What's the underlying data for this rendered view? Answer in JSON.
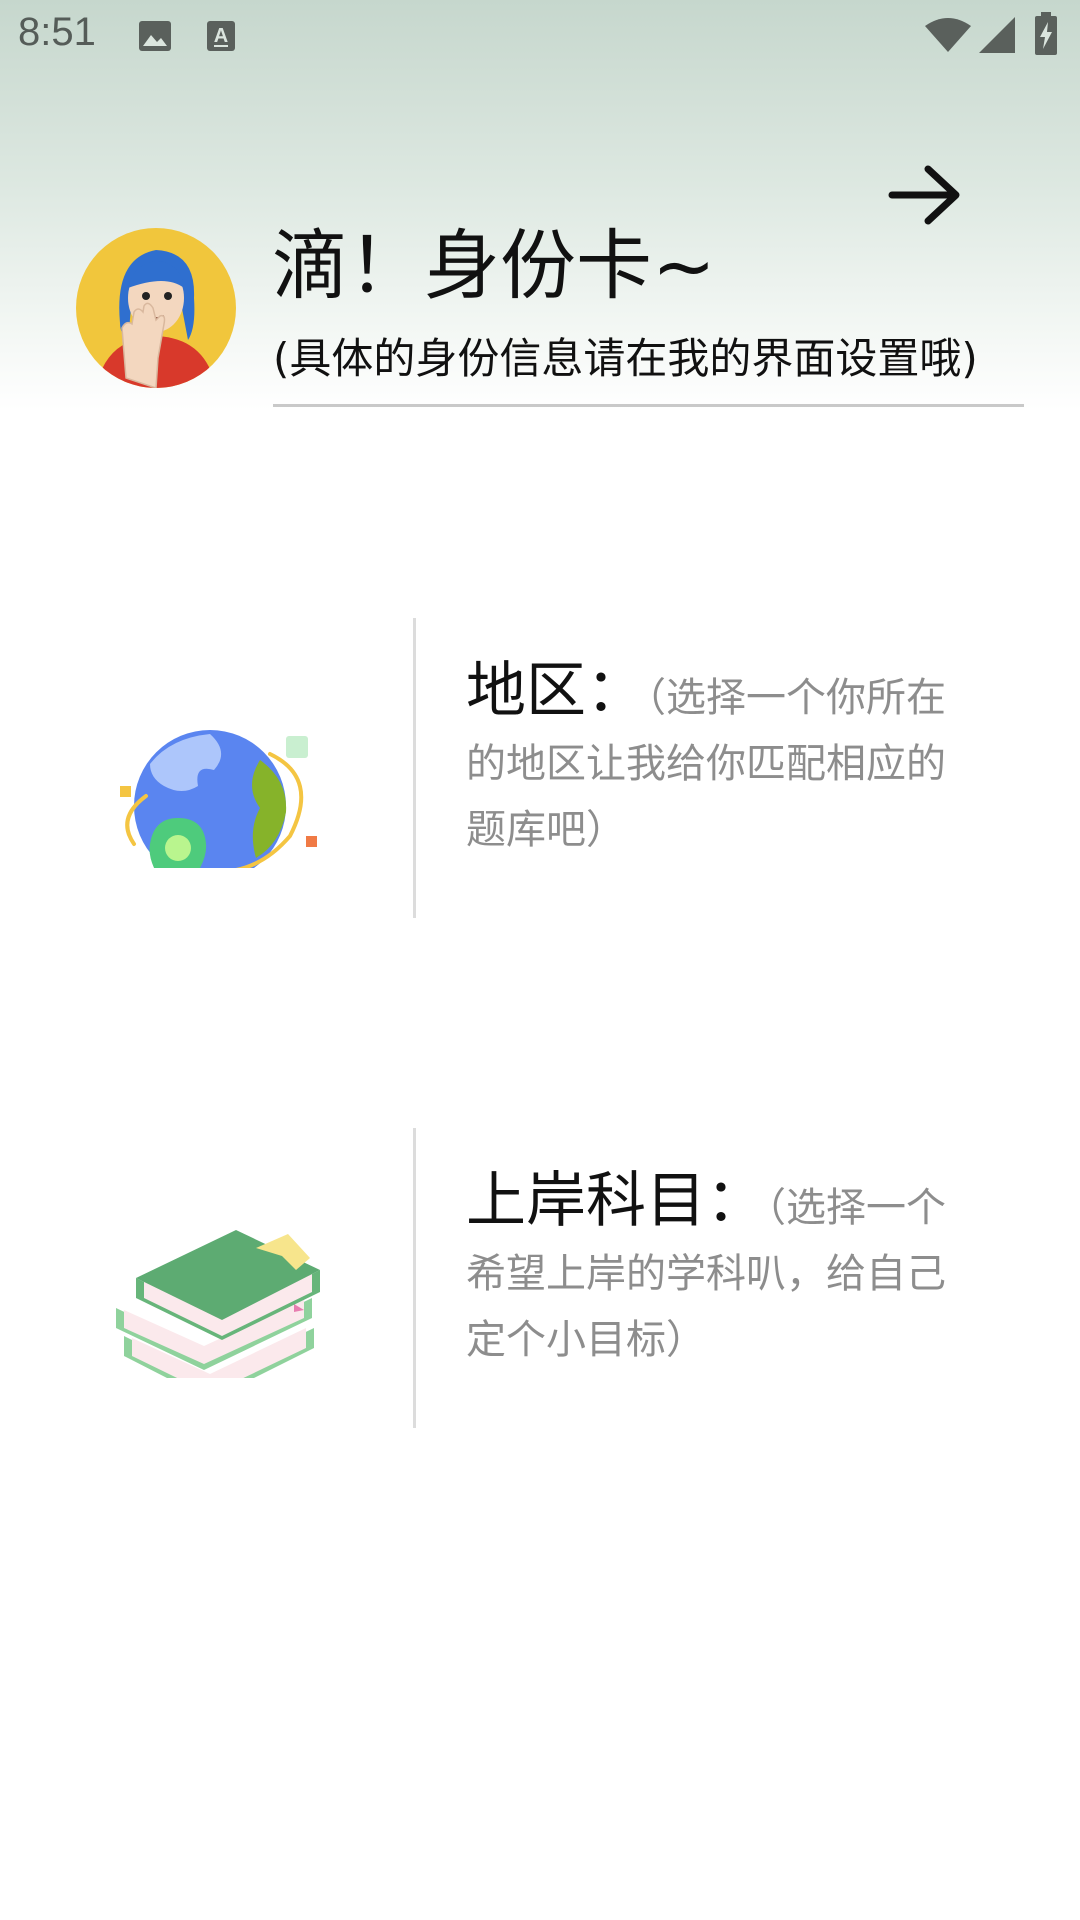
{
  "status_bar": {
    "time": "8:51",
    "icons": [
      "image-icon",
      "text-a-icon",
      "wifi-icon",
      "signal-icon",
      "battery-charging-icon"
    ]
  },
  "identity_card": {
    "title": "滴！身份卡~",
    "subtitle": "(具体的身份信息请在我的界面设置哦)",
    "next_icon": "arrow-right-icon"
  },
  "options": [
    {
      "label": "地区：",
      "description": "（选择一个你所在的地区让我给你匹配相应的题库吧）",
      "icon": "globe-location-icon"
    },
    {
      "label": "上岸科目：",
      "description": "（选择一个希望上岸的学科叭，给自己定个小目标）",
      "icon": "books-icon"
    }
  ],
  "colors": {
    "header_top": "#c6d7cd",
    "title_text": "#111111",
    "hint_text": "#8d8d8d",
    "divider": "#dcdcdc"
  }
}
